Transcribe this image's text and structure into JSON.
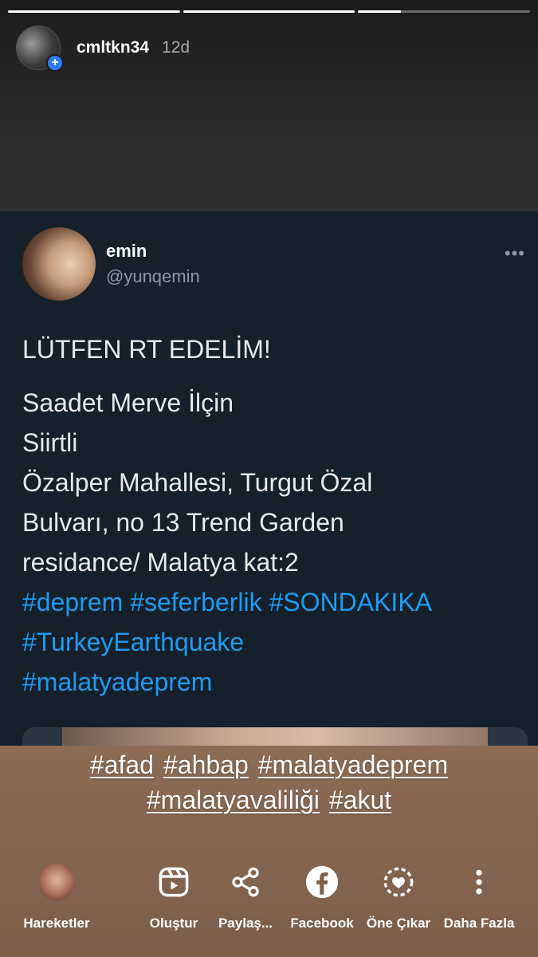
{
  "story": {
    "progress": [
      1,
      1,
      0.25
    ],
    "username": "cmltkn34",
    "time": "12d"
  },
  "tweet": {
    "name": "emin",
    "handle": "@yunqemin",
    "more": "•••",
    "headline": "LÜTFEN RT EDELİM!",
    "lines": [
      "Saadet Merve İlçin",
      "Siirtli",
      "Özalper Mahallesi, Turgut Özal",
      "Bulvarı, no 13 Trend Garden",
      "residance/ Malatya kat:2"
    ],
    "hashtags": [
      "#deprem #seferberlik #SONDAKIKA",
      "#TurkeyEarthquake",
      "#malatyadeprem"
    ]
  },
  "caption": {
    "line1": [
      "#afad",
      "#ahbap",
      "#malatyadeprem"
    ],
    "line2": [
      "#malatyavaliliği",
      "#akut"
    ]
  },
  "actions": [
    {
      "label": "Hareketler",
      "icon": "activity-avatar"
    },
    {
      "label": "Oluştur",
      "icon": "reels-icon"
    },
    {
      "label": "Paylaş...",
      "icon": "share-icon"
    },
    {
      "label": "Facebook",
      "icon": "facebook-icon"
    },
    {
      "label": "Öne Çıkar",
      "icon": "highlight-icon"
    },
    {
      "label": "Daha Fazla",
      "icon": "more-vertical-icon"
    }
  ]
}
